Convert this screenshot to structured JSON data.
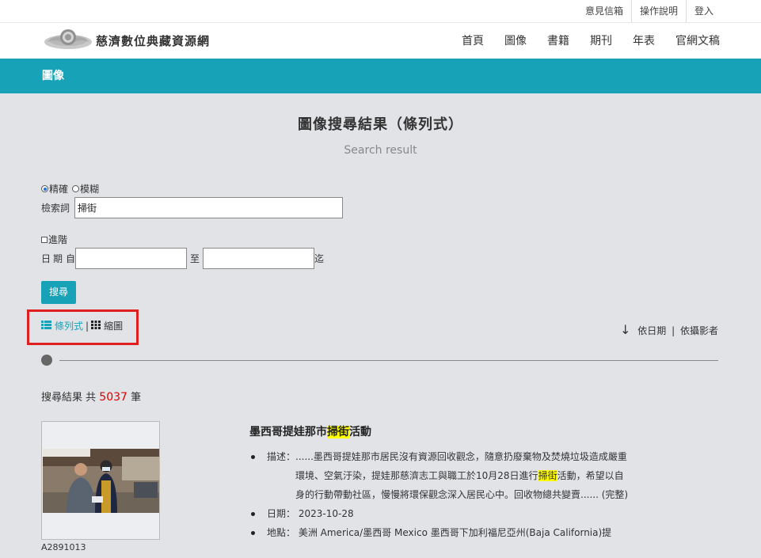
{
  "topbar": {
    "links": [
      "意見信箱",
      "操作說明",
      "登入"
    ]
  },
  "site": {
    "name": "慈濟數位典藏資源網"
  },
  "nav": {
    "items": [
      "首頁",
      "圖像",
      "書籍",
      "期刊",
      "年表",
      "官網文稿"
    ]
  },
  "banner": {
    "label": "圖像"
  },
  "page": {
    "title": "圖像搜尋結果（條列式）",
    "subtitle": "Search result"
  },
  "form": {
    "exact_label": "精確",
    "fuzzy_label": "模糊",
    "exact_selected": true,
    "keyword_label": "檢索詞",
    "keyword_value": "掃街",
    "advanced_label": "進階",
    "advanced_checked": false,
    "date_label": "日期",
    "date_from_label": "自",
    "date_from_value": "",
    "date_to_label": "至",
    "date_end_label": "迄",
    "date_to_value": "",
    "search_button": "搜尋"
  },
  "view": {
    "list_label": "條列式",
    "sep": "|",
    "grid_label": "縮圖"
  },
  "sort": {
    "arrow": "↓",
    "by_date": "依日期",
    "sep": "|",
    "by_photographer": "依攝影者"
  },
  "results": {
    "prefix": "搜尋結果 共",
    "count": "5037",
    "suffix": "筆",
    "item": {
      "id": "A2891013",
      "title_before": "墨西哥提娃那市",
      "title_mark": "掃街",
      "title_after": "活動",
      "desc_label": "描述：",
      "desc_before": "......墨西哥提娃那市居民沒有資源回收觀念，隨意扔廢棄物及焚燒垃圾造成嚴重環境、空氣汙染，提娃那慈濟志工與職工於10月28日進行",
      "desc_mark": "掃街",
      "desc_after": "活動，希望以自身的行動帶動社區，慢慢將環保觀念深入居民心中。回收物總共變賣...... (完整)",
      "date_label": "日期：",
      "date_value": "2023-10-28",
      "place_label": "地點：",
      "place_value": "美洲 America/墨西哥 Mexico 墨西哥下加利福尼亞州(Baja California)提"
    }
  },
  "colors": {
    "accent": "#17a2b8",
    "count": "#dd0000",
    "highlight": "#ffff00",
    "annotation_box": "#e02020"
  }
}
